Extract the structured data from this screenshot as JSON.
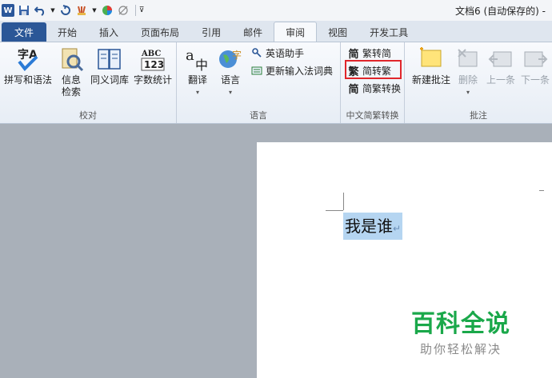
{
  "titlebar": {
    "app_icon": "W",
    "quick_access": [
      "save-icon",
      "undo-icon",
      "redo-icon",
      "format-painter-icon",
      "color-icon",
      "clear-icon",
      "customize-icon"
    ],
    "title": "文档6 (自动保存的) -"
  },
  "tabs": [
    {
      "label": "文件",
      "kind": "file"
    },
    {
      "label": "开始",
      "kind": "normal"
    },
    {
      "label": "插入",
      "kind": "normal"
    },
    {
      "label": "页面布局",
      "kind": "normal"
    },
    {
      "label": "引用",
      "kind": "normal"
    },
    {
      "label": "邮件",
      "kind": "normal"
    },
    {
      "label": "审阅",
      "kind": "active"
    },
    {
      "label": "视图",
      "kind": "normal"
    },
    {
      "label": "开发工具",
      "kind": "normal"
    }
  ],
  "ribbon": {
    "proofing": {
      "label": "校对",
      "spelling": "拼写和语法",
      "research_line1": "信息",
      "research_line2": "检索",
      "thesaurus": "同义词库",
      "word_count": "字数统计"
    },
    "language": {
      "label": "语言",
      "translate": "翻译",
      "language": "语言",
      "english_assistant": "英语助手",
      "update_ime": "更新输入法词典"
    },
    "chinese_conversion": {
      "label": "中文简繁转换",
      "trad_to_simp": "繁转简",
      "simp_to_trad": "简转繁",
      "convert": "简繁转换",
      "glyph_trad_simp": "简",
      "glyph_simp_trad": "繁",
      "glyph_convert": "简"
    },
    "comments": {
      "label": "批注",
      "new_comment": "新建批注",
      "delete": "删除",
      "previous": "上一条",
      "next": "下一条"
    }
  },
  "document": {
    "selected_text": "我是谁",
    "paragraph_mark": "↵"
  },
  "watermark": {
    "title": "百科全说",
    "subtitle": "助你轻松解决"
  },
  "colors": {
    "file_tab": "#2b5797",
    "highlight_box": "#e0262b",
    "selection": "#b5d5f1",
    "watermark_green": "#1aa84a"
  }
}
